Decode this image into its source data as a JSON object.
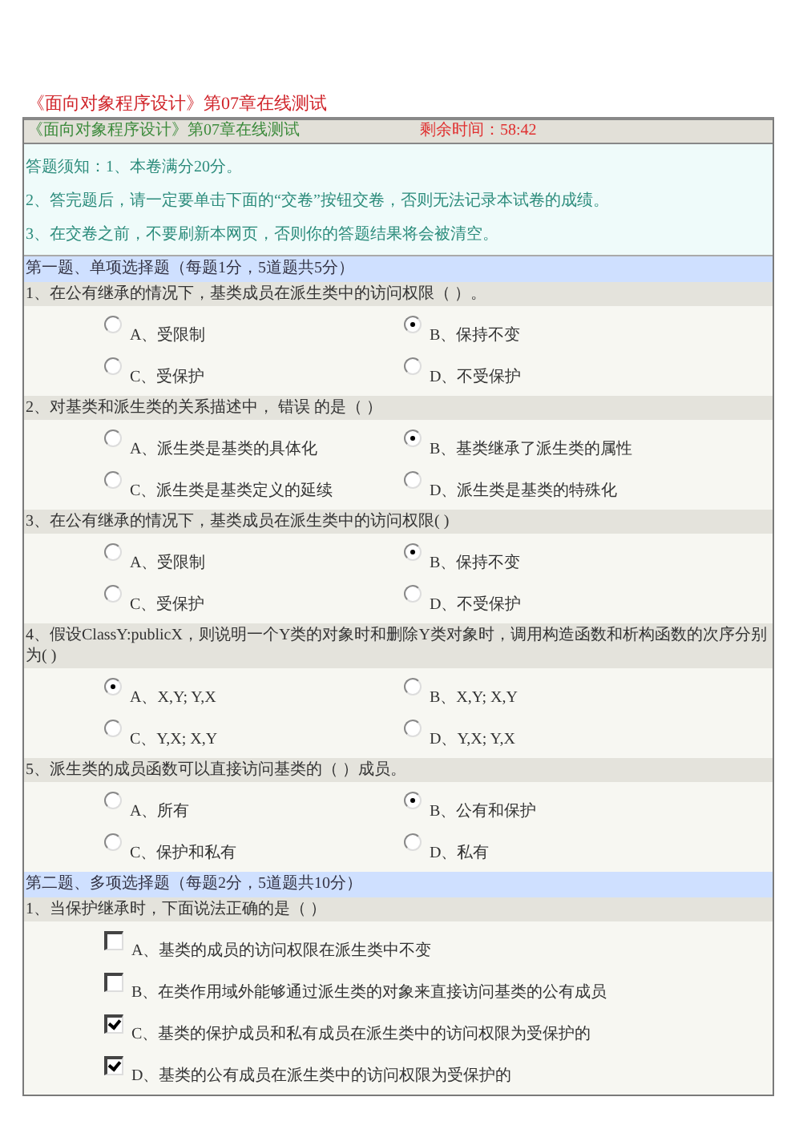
{
  "page_title": "《面向对象程序设计》第07章在线测试",
  "exam_bar": {
    "title": "《面向对象程序设计》第07章在线测试",
    "timer": "剩余时间：58:42"
  },
  "notice": [
    "答题须知：1、本卷满分20分。",
    "2、答完题后，请一定要单击下面的“交卷”按钮交卷，否则无法记录本试卷的成绩。",
    "3、在交卷之前，不要刷新本网页，否则你的答题结果将会被清空。"
  ],
  "sections": [
    {
      "title": "第一题、单项选择题（每题1分，5道题共5分）",
      "kind": "single",
      "questions": [
        {
          "text": "1、在公有继承的情况下，基类成员在派生类中的访问权限（ ）。",
          "options": [
            {
              "label": "A、受限制",
              "selected": false
            },
            {
              "label": "B、保持不变",
              "selected": true
            },
            {
              "label": "C、受保护",
              "selected": false
            },
            {
              "label": "D、不受保护",
              "selected": false
            }
          ]
        },
        {
          "text": "2、对基类和派生类的关系描述中， 错误 的是（ ）",
          "options": [
            {
              "label": "A、派生类是基类的具体化",
              "selected": false
            },
            {
              "label": "B、基类继承了派生类的属性",
              "selected": true
            },
            {
              "label": "C、派生类是基类定义的延续",
              "selected": false
            },
            {
              "label": "D、派生类是基类的特殊化",
              "selected": false
            }
          ]
        },
        {
          "text": "3、在公有继承的情况下，基类成员在派生类中的访问权限( )",
          "options": [
            {
              "label": "A、受限制",
              "selected": false
            },
            {
              "label": "B、保持不变",
              "selected": true
            },
            {
              "label": "C、受保护",
              "selected": false
            },
            {
              "label": "D、不受保护",
              "selected": false
            }
          ]
        },
        {
          "text": "4、假设ClassY:publicX，则说明一个Y类的对象时和删除Y类对象时，调用构造函数和析构函数的次序分别为( )",
          "options": [
            {
              "label": "A、X,Y; Y,X",
              "selected": true
            },
            {
              "label": "B、X,Y; X,Y",
              "selected": false
            },
            {
              "label": "C、Y,X; X,Y",
              "selected": false
            },
            {
              "label": "D、Y,X; Y,X",
              "selected": false
            }
          ]
        },
        {
          "text": "5、派生类的成员函数可以直接访问基类的（ ）成员。",
          "options": [
            {
              "label": "A、所有",
              "selected": false
            },
            {
              "label": "B、公有和保护",
              "selected": true
            },
            {
              "label": "C、保护和私有",
              "selected": false
            },
            {
              "label": "D、私有",
              "selected": false
            }
          ]
        }
      ]
    },
    {
      "title": "第二题、多项选择题（每题2分，5道题共10分）",
      "kind": "multiple",
      "questions": [
        {
          "text": "1、当保护继承时，下面说法正确的是（ ）",
          "options": [
            {
              "label": "A、基类的成员的访问权限在派生类中不变",
              "checked": false
            },
            {
              "label": "B、在类作用域外能够通过派生类的对象来直接访问基类的公有成员",
              "checked": false
            },
            {
              "label": "C、基类的保护成员和私有成员在派生类中的访问权限为受保护的",
              "checked": true
            },
            {
              "label": "D、基类的公有成员在派生类中的访问权限为受保护的",
              "checked": true
            }
          ]
        }
      ]
    }
  ]
}
